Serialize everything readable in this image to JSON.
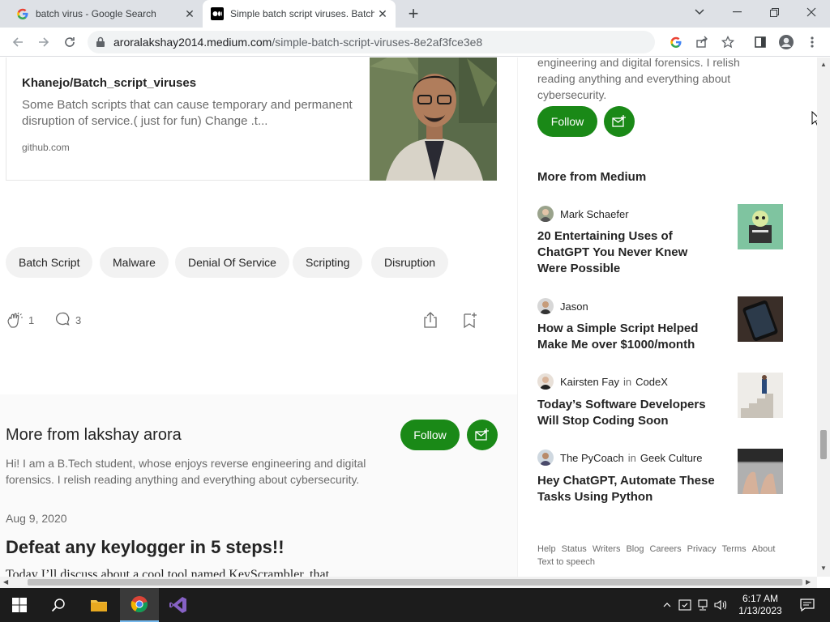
{
  "browser": {
    "tabs": [
      {
        "title": "batch virus - Google Search",
        "active": false
      },
      {
        "title": "Simple batch script viruses. Batch",
        "active": true
      }
    ],
    "new_tab_label": "+",
    "url_host": "aroralakshay2014.medium.com",
    "url_path": "/simple-batch-script-viruses-8e2af3fce3e8"
  },
  "link_card": {
    "title": "Khanejo/Batch_script_viruses",
    "description": "Some Batch scripts that can cause temporary and permanent disruption of service.( just for fun) Change .t...",
    "domain": "github.com"
  },
  "tags": [
    "Batch Script",
    "Malware",
    "Denial Of Service",
    "Scripting",
    "Disruption"
  ],
  "reactions": {
    "claps": "1",
    "comments": "3"
  },
  "more_from_author": {
    "heading": "More from lakshay arora",
    "follow_label": "Follow",
    "bio": "Hi! I am a B.Tech student, whose enjoys reverse engineering and digital forensics. I relish reading anything and everything about cybersecurity.",
    "post_date": "Aug 9, 2020",
    "post_title": "Defeat any keylogger in 5 steps!!",
    "post_snippet": "Today I’ll discuss about a cool tool named KeyScrambler, that"
  },
  "sidebar": {
    "bio_tail": "engineering and digital forensics. I relish reading anything and everything about cybersecurity.",
    "follow_label": "Follow",
    "more_heading": "More from Medium",
    "recommendations": [
      {
        "author": "Mark Schaefer",
        "publication_prefix": "",
        "publication": "",
        "title": "20 Entertaining Uses of ChatGPT You Never Knew Were Possible"
      },
      {
        "author": "Jason",
        "publication_prefix": "",
        "publication": "",
        "title": "How a Simple Script Helped Make Me over $1000/month"
      },
      {
        "author": "Kairsten Fay",
        "publication_prefix": "in",
        "publication": "CodeX",
        "title": "Today’s Software Developers Will Stop Coding Soon"
      },
      {
        "author": "The PyCoach",
        "publication_prefix": "in",
        "publication": "Geek Culture",
        "title": "Hey ChatGPT, Automate These Tasks Using Python"
      }
    ],
    "footer_links": [
      "Help",
      "Status",
      "Writers",
      "Blog",
      "Careers",
      "Privacy",
      "Terms",
      "About"
    ],
    "footer_extra": "Text to speech"
  },
  "taskbar": {
    "time": "6:17 AM",
    "date": "1/13/2023"
  },
  "colors": {
    "medium_green": "#1a8917",
    "tab_strip": "#dee1e6",
    "taskbar": "#1c1c1c"
  }
}
